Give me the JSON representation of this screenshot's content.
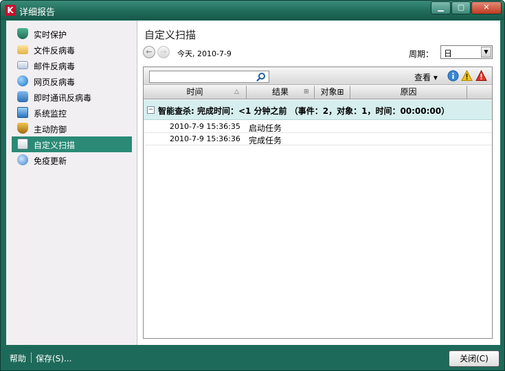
{
  "window": {
    "title": "详细报告",
    "app_icon": "kaspersky-icon",
    "minimize_glyph": "▁",
    "maximize_glyph": "▢",
    "close_glyph": "✕"
  },
  "sidebar": {
    "items": [
      {
        "label": "实时保护",
        "icon": "shield-icon",
        "active": false
      },
      {
        "label": "文件反病毒",
        "icon": "folder-icon",
        "active": false
      },
      {
        "label": "邮件反病毒",
        "icon": "mail-icon",
        "active": false
      },
      {
        "label": "网页反病毒",
        "icon": "globe-icon",
        "active": false
      },
      {
        "label": "即时通讯反病毒",
        "icon": "chat-icon",
        "active": false
      },
      {
        "label": "系统监控",
        "icon": "monitor-icon",
        "active": false
      },
      {
        "label": "主动防御",
        "icon": "defense-shield-icon",
        "active": false
      },
      {
        "label": "自定义扫描",
        "icon": "scan-icon",
        "active": true
      },
      {
        "label": "免疫更新",
        "icon": "update-icon",
        "active": false
      }
    ]
  },
  "main": {
    "title": "自定义扫描",
    "back_glyph": "←",
    "forward_glyph": "→",
    "today_label": "今天, 2010-7-9",
    "period_label": "周期：",
    "period_value": "日",
    "period_arrow": "▼"
  },
  "toolbar": {
    "search_value": "",
    "view_label": "查看 ▾",
    "filters": [
      "info-icon",
      "warning-icon",
      "critical-icon"
    ]
  },
  "table": {
    "columns": [
      {
        "label": "时间",
        "mark": "△"
      },
      {
        "label": "结果",
        "mark": "⊞"
      },
      {
        "label": "对象⊞",
        "mark": ""
      },
      {
        "label": "原因",
        "mark": ""
      },
      {
        "label": "",
        "mark": ""
      }
    ],
    "group": {
      "toggle": "−",
      "text": "智能查杀: 完成时间：<1 分钟之前 （事件：2，对象：1，时间：00:00:00）"
    },
    "rows": [
      {
        "time": "2010-7-9 15:36:35",
        "result": "启动任务"
      },
      {
        "time": "2010-7-9 15:36:36",
        "result": "完成任务"
      }
    ]
  },
  "footer": {
    "help_label": "帮助",
    "save_label": "保存(S)...",
    "close_label": "关闭(C)"
  },
  "colors": {
    "frame": "#1e6a5a",
    "active_item": "#2a8a76",
    "group_row": "#d6eeee"
  }
}
